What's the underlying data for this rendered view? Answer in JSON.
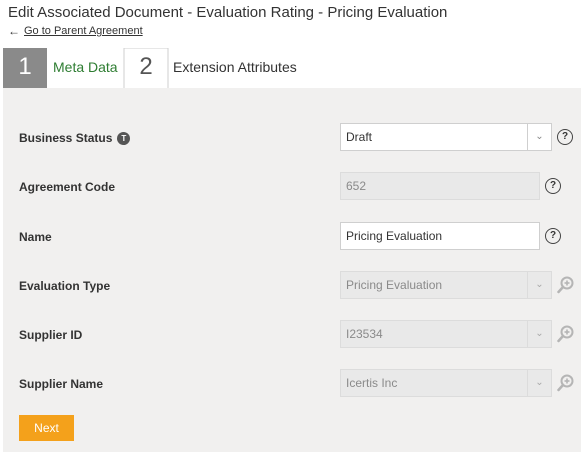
{
  "header": {
    "title": "Edit Associated Document - Evaluation Rating - Pricing Evaluation",
    "back_link": "Go to Parent Agreement"
  },
  "steps": [
    {
      "number": "1",
      "label": "Meta Data",
      "active": true
    },
    {
      "number": "2",
      "label": "Extension Attributes",
      "active": false
    }
  ],
  "form": {
    "business_status": {
      "label": "Business Status",
      "badge": "T",
      "value": "Draft"
    },
    "agreement_code": {
      "label": "Agreement Code",
      "value": "652"
    },
    "name": {
      "label": "Name",
      "value": "Pricing Evaluation"
    },
    "evaluation_type": {
      "label": "Evaluation Type",
      "value": "Pricing Evaluation"
    },
    "supplier_id": {
      "label": "Supplier ID",
      "value": "I23534"
    },
    "supplier_name": {
      "label": "Supplier Name",
      "value": "Icertis Inc"
    },
    "help_glyph": "?",
    "caret_glyph": "⌄"
  },
  "actions": {
    "next_label": "Next"
  },
  "colors": {
    "accent": "#f4a11b",
    "step_active": "#8a8a8a",
    "step_label_active": "#2e7d32",
    "panel_bg": "#f1f0ef"
  }
}
